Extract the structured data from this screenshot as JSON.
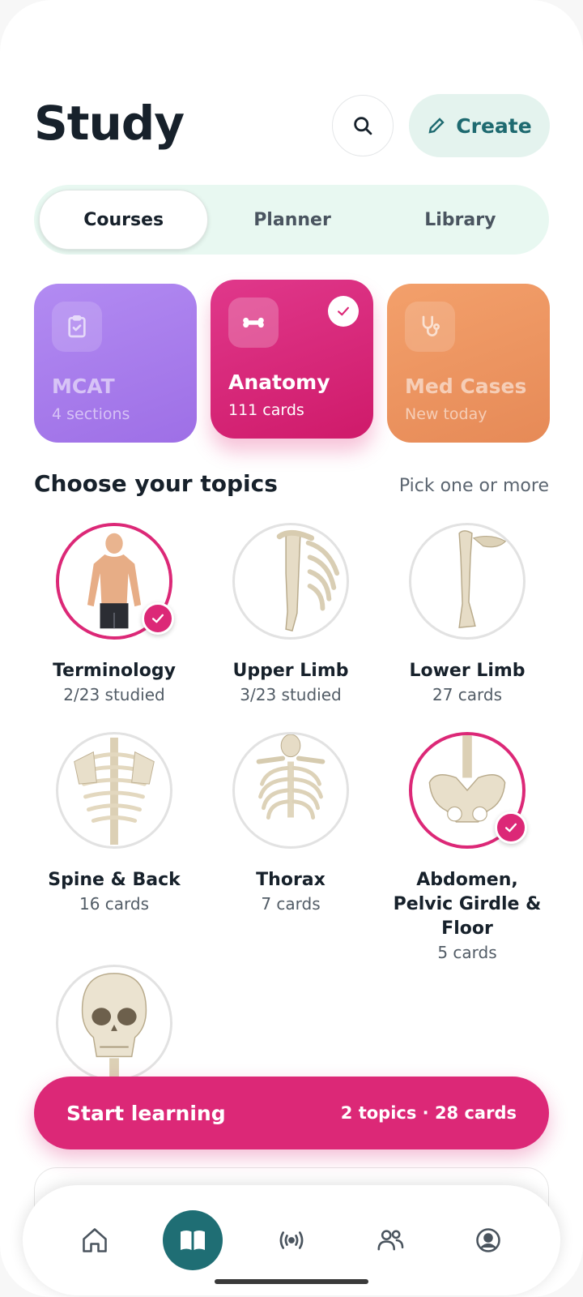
{
  "header": {
    "title": "Study",
    "search_icon": "search-icon",
    "create_label": "Create",
    "create_icon": "pencil-icon"
  },
  "tabs": [
    {
      "label": "Courses",
      "active": true
    },
    {
      "label": "Planner",
      "active": false
    },
    {
      "label": "Library",
      "active": false
    }
  ],
  "courses": [
    {
      "name": "MCAT",
      "subtitle": "4 sections",
      "icon": "clipboard-check-icon",
      "color": "#a77cec",
      "selected": false
    },
    {
      "name": "Anatomy",
      "subtitle": "111 cards",
      "icon": "bone-icon",
      "color": "#d8237a",
      "selected": true
    },
    {
      "name": "Med Cases",
      "subtitle": "New today",
      "icon": "stethoscope-icon",
      "color": "#ec9461",
      "selected": false
    }
  ],
  "topics_section": {
    "title": "Choose your topics",
    "hint": "Pick one or more"
  },
  "topics": [
    {
      "name": "Terminology",
      "subtitle": "2/23 studied",
      "selected": true
    },
    {
      "name": "Upper Limb",
      "subtitle": "3/23 studied",
      "selected": false
    },
    {
      "name": "Lower Limb",
      "subtitle": "27 cards",
      "selected": false
    },
    {
      "name": "Spine & Back",
      "subtitle": "16 cards",
      "selected": false
    },
    {
      "name": "Thorax",
      "subtitle": "7 cards",
      "selected": false
    },
    {
      "name": "Abdomen, Pelvic Girdle & Floor",
      "subtitle": "5 cards",
      "selected": true
    },
    {
      "name": "",
      "subtitle": "",
      "selected": false
    }
  ],
  "start": {
    "label": "Start learning",
    "summary": "2 topics · 28 cards"
  },
  "nav": [
    {
      "icon": "home-icon",
      "active": false
    },
    {
      "icon": "open-book-icon",
      "active": true
    },
    {
      "icon": "broadcast-icon",
      "active": false
    },
    {
      "icon": "people-icon",
      "active": false
    },
    {
      "icon": "profile-icon",
      "active": false
    }
  ],
  "colors": {
    "accent": "#dc2877",
    "teal": "#1f6e74",
    "segment_bg": "#e8f8f1"
  }
}
